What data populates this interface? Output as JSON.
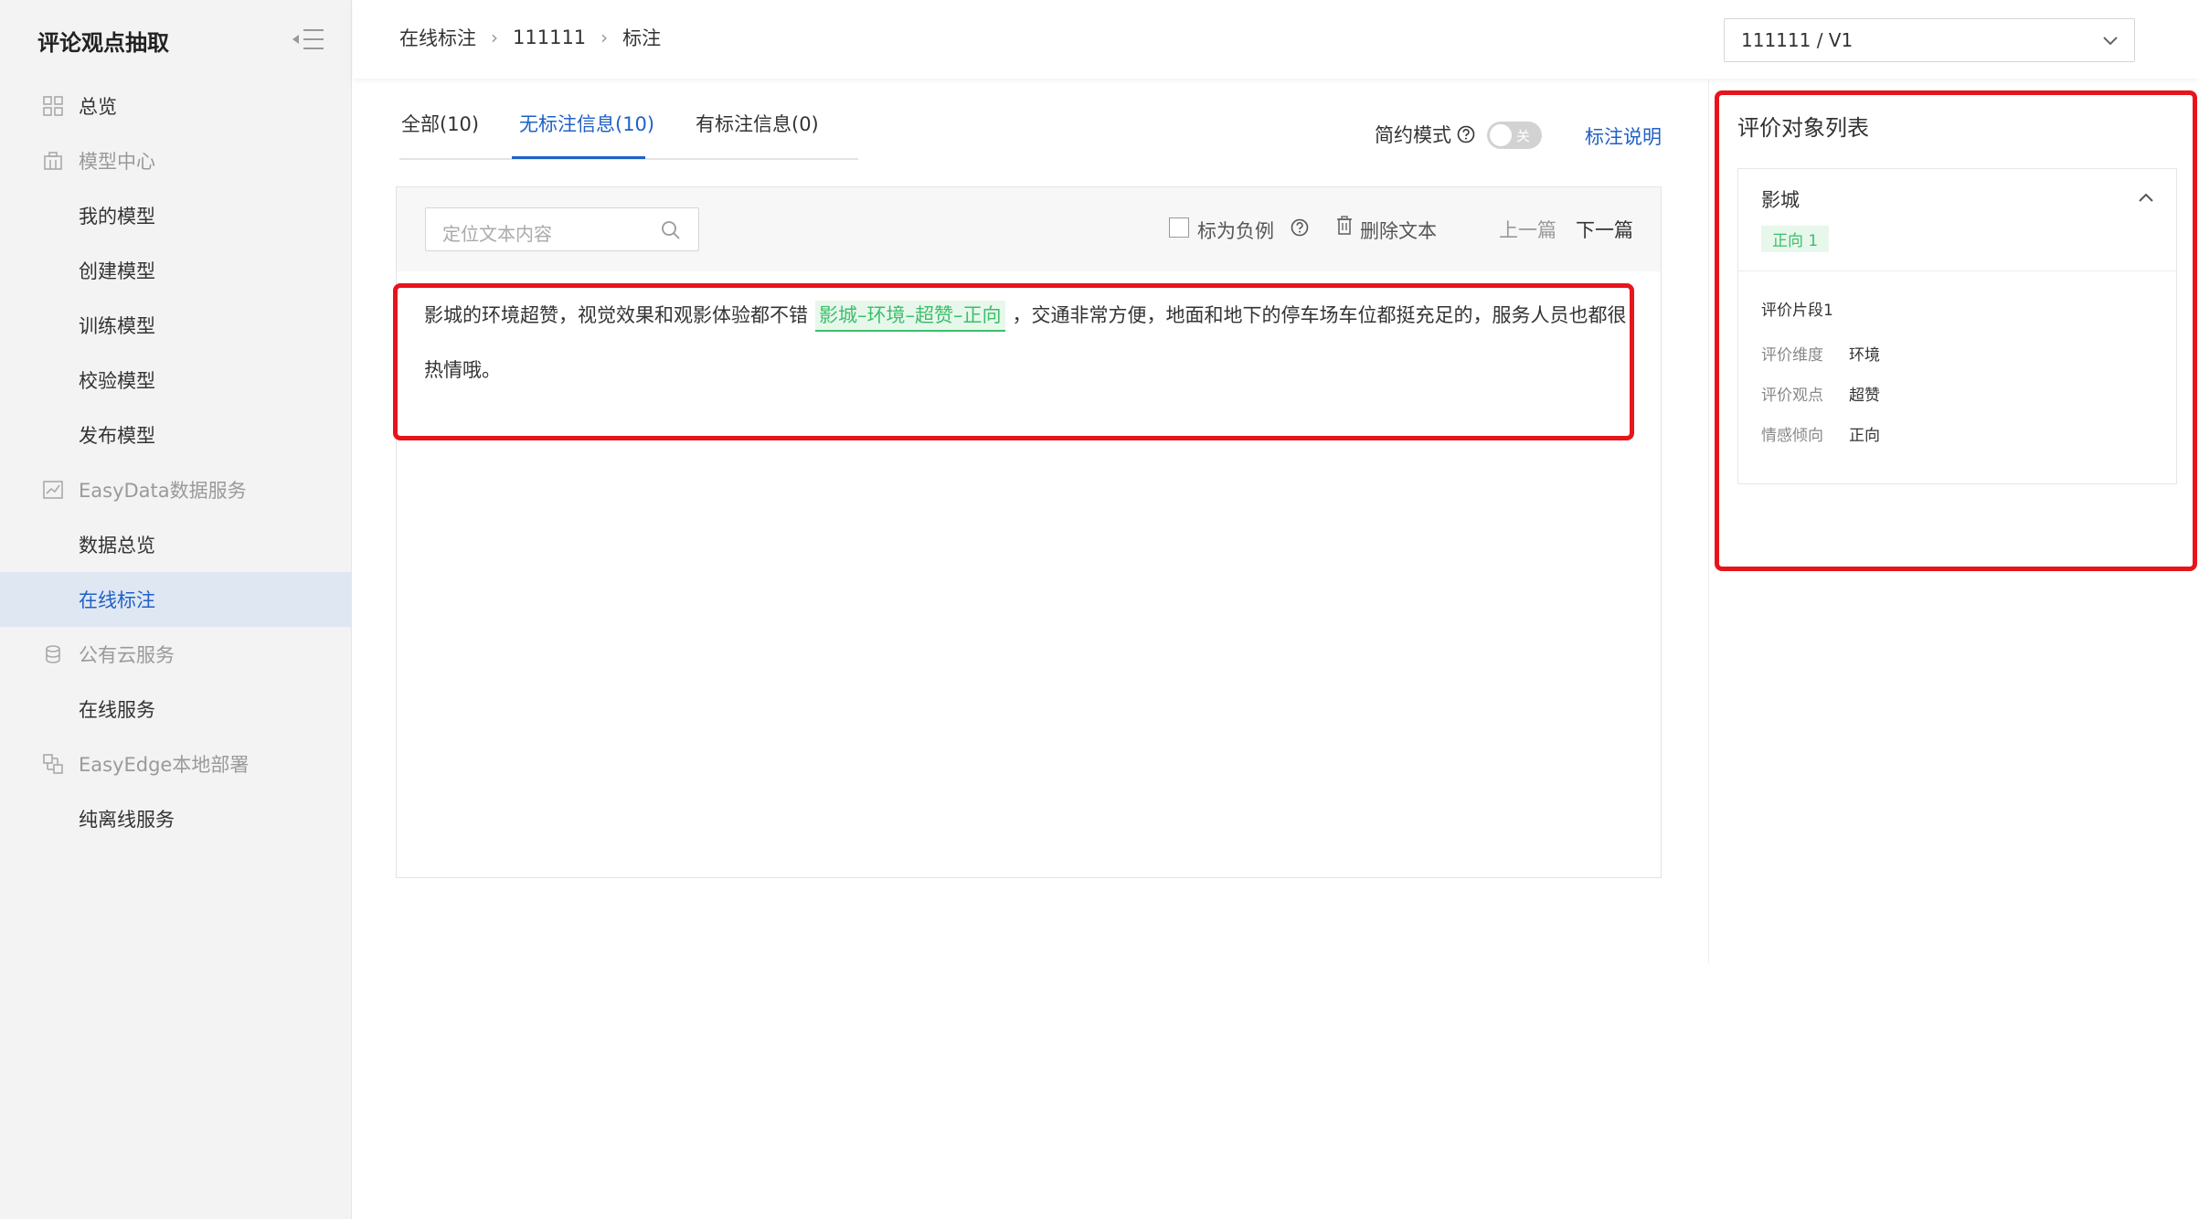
{
  "sidebar": {
    "title": "评论观点抽取",
    "items": [
      {
        "label": "总览"
      },
      {
        "label": "模型中心"
      },
      {
        "label": "我的模型"
      },
      {
        "label": "创建模型"
      },
      {
        "label": "训练模型"
      },
      {
        "label": "校验模型"
      },
      {
        "label": "发布模型"
      },
      {
        "label": "EasyData数据服务"
      },
      {
        "label": "数据总览"
      },
      {
        "label": "在线标注"
      },
      {
        "label": "公有云服务"
      },
      {
        "label": "在线服务"
      },
      {
        "label": "EasyEdge本地部署"
      },
      {
        "label": "纯离线服务"
      }
    ]
  },
  "header": {
    "breadcrumb": [
      "在线标注",
      "111111",
      "标注"
    ],
    "version": "111111 / V1"
  },
  "tabs": [
    {
      "label": "全部(10)"
    },
    {
      "label": "无标注信息(10)"
    },
    {
      "label": "有标注信息(0)"
    }
  ],
  "toolbar": {
    "mode_label": "简约模式",
    "toggle_label": "关",
    "help_link": "标注说明",
    "search_placeholder": "定位文本内容",
    "negative_label": "标为负例",
    "delete_label": "删除文本",
    "prev_label": "上一篇",
    "next_label": "下一篇"
  },
  "content": {
    "text_before": "影城的环境超赞，视觉效果和观影体验都不错",
    "highlight": "影城–环境–超赞–正向",
    "text_after": "，交通非常方便，地面和地下的停车场车位都挺充足的，服务人员也都很热情哦。"
  },
  "right_panel": {
    "title": "评价对象列表",
    "card": {
      "name": "影城",
      "badge": "正向 1",
      "segment_title": "评价片段1",
      "rows": [
        {
          "key": "评价维度",
          "value": "环境"
        },
        {
          "key": "评价观点",
          "value": "超赞"
        },
        {
          "key": "情感倾向",
          "value": "正向"
        }
      ]
    }
  },
  "colors": {
    "accent": "#1f61c6",
    "positive": "#3bbf69",
    "highlight_bg": "#e8f7ec",
    "annotation_red": "#e8141c",
    "sidebar_bg": "#f3f3f3",
    "sidebar_active_bg": "#dfe7f3"
  }
}
